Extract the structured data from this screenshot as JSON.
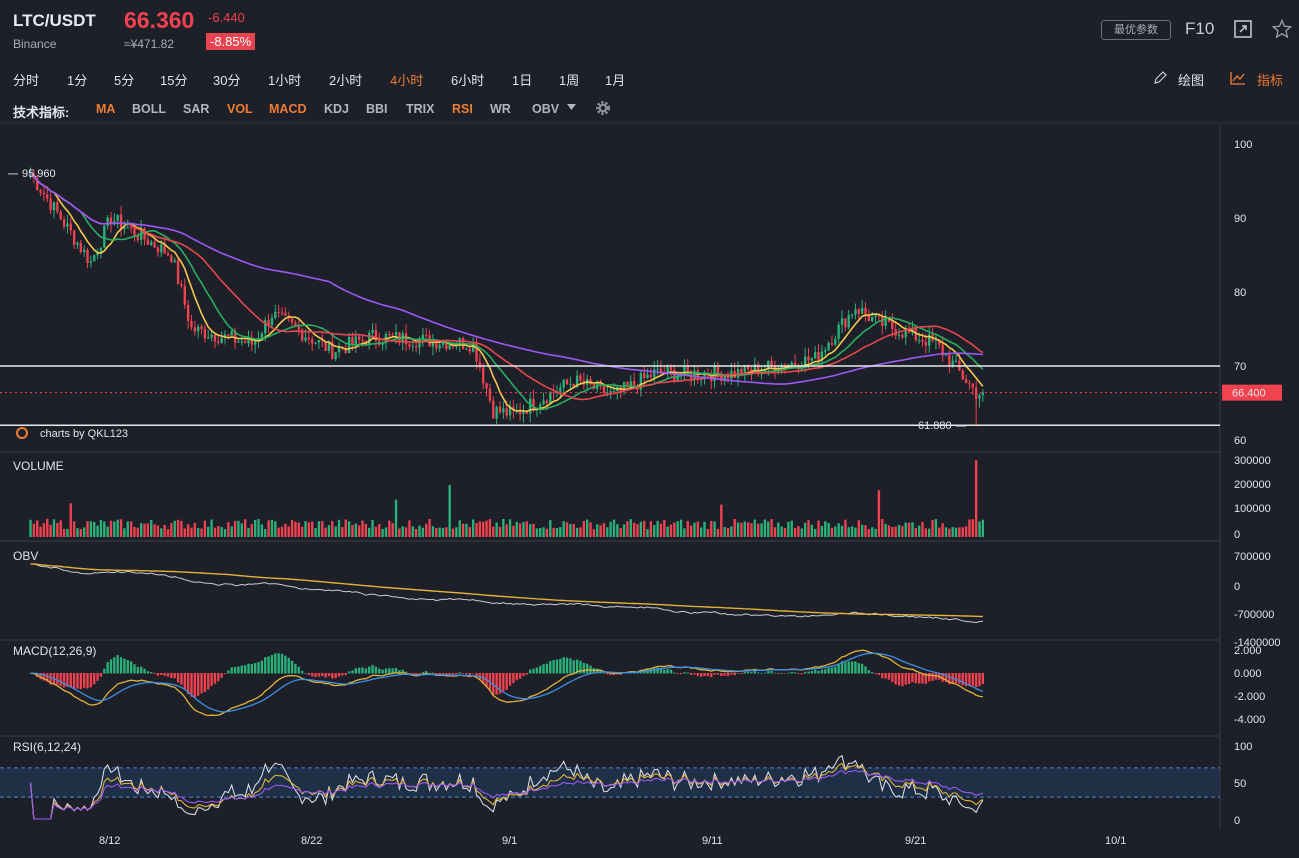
{
  "header": {
    "symbol": "LTC/USDT",
    "exchange": "Binance",
    "price": "66.360",
    "change": "-6.440",
    "cny": "≈¥471.82",
    "change_pct": "-8.85%",
    "best_params_label": "最优参数",
    "f10_label": "F10"
  },
  "periods": [
    "分时",
    "1分",
    "5分",
    "15分",
    "30分",
    "1小时",
    "2小时",
    "4小时",
    "6小时",
    "1日",
    "1周",
    "1月"
  ],
  "active_period": "4小时",
  "tools": {
    "draw_label": "绘图",
    "indicator_label": "指标"
  },
  "indicators": {
    "label": "技术指标:",
    "items": [
      {
        "name": "MA",
        "active": true
      },
      {
        "name": "BOLL",
        "active": false
      },
      {
        "name": "SAR",
        "active": false
      },
      {
        "name": "VOL",
        "active": true
      },
      {
        "name": "MACD",
        "active": true
      },
      {
        "name": "KDJ",
        "active": false
      },
      {
        "name": "BBI",
        "active": false
      },
      {
        "name": "TRIX",
        "active": false
      },
      {
        "name": "RSI",
        "active": true
      },
      {
        "name": "WR",
        "active": false
      },
      {
        "name": "OBV",
        "active": false
      }
    ]
  },
  "chart": {
    "price_axis": [
      "100",
      "90",
      "80",
      "70",
      "60"
    ],
    "high_label": "95.960",
    "low_label": "61.880",
    "last_price_tag": "66.400",
    "watermark": "charts by QKL123",
    "date_axis": [
      "8/12",
      "8/22",
      "9/1",
      "9/11",
      "9/21",
      "10/1"
    ],
    "volume_title": "VOLUME",
    "volume_axis": [
      "300000",
      "200000",
      "100000",
      "0"
    ],
    "obv_title": "OBV",
    "obv_axis": [
      "700000",
      "0",
      "-700000",
      "-1400000"
    ],
    "macd_title": "MACD(12,26,9)",
    "macd_axis": [
      "2.000",
      "0.000",
      "-2.000",
      "-4.000"
    ],
    "rsi_title": "RSI(6,12,24)",
    "rsi_axis": [
      "100",
      "50",
      "0"
    ],
    "colors": {
      "up": "#2ab27b",
      "down": "#f0424f",
      "ma_fast": "#f2c94c",
      "ma_mid": "#27ae60",
      "ma_slow": "#e5484d",
      "ma_long": "#9b59f6",
      "accent": "#ef7d32"
    }
  },
  "chart_data": {
    "type": "candlestick",
    "symbol": "LTC/USDT",
    "interval": "4小时",
    "x_dates": [
      "8/12",
      "8/22",
      "9/1",
      "9/11",
      "9/21",
      "10/1"
    ],
    "price_range": [
      60,
      100
    ],
    "price_keypoints": [
      {
        "date": "8/8",
        "close": 95.96
      },
      {
        "date": "8/11",
        "close": 84
      },
      {
        "date": "8/12",
        "close": 90
      },
      {
        "date": "8/15",
        "close": 85
      },
      {
        "date": "8/16",
        "close": 75
      },
      {
        "date": "8/19",
        "close": 73
      },
      {
        "date": "8/20",
        "close": 77
      },
      {
        "date": "8/23",
        "close": 72
      },
      {
        "date": "8/25",
        "close": 74
      },
      {
        "date": "8/30",
        "close": 73
      },
      {
        "date": "8/31",
        "close": 64
      },
      {
        "date": "9/1",
        "close": 63.5
      },
      {
        "date": "9/4",
        "close": 68
      },
      {
        "date": "9/6",
        "close": 66
      },
      {
        "date": "9/8",
        "close": 69
      },
      {
        "date": "9/12",
        "close": 69
      },
      {
        "date": "9/16",
        "close": 71
      },
      {
        "date": "9/18",
        "close": 78
      },
      {
        "date": "9/19",
        "close": 76
      },
      {
        "date": "9/22",
        "close": 73
      },
      {
        "date": "9/24",
        "close": 66.4
      }
    ],
    "horizontal_levels": [
      70,
      62
    ],
    "high": 95.96,
    "low": 61.88,
    "last": 66.4,
    "volume_range": [
      0,
      300000
    ],
    "obv_range": [
      -1400000,
      700000
    ],
    "macd_range": [
      -4,
      2
    ],
    "rsi_range": [
      0,
      100
    ],
    "rsi_band": [
      30,
      70
    ]
  }
}
